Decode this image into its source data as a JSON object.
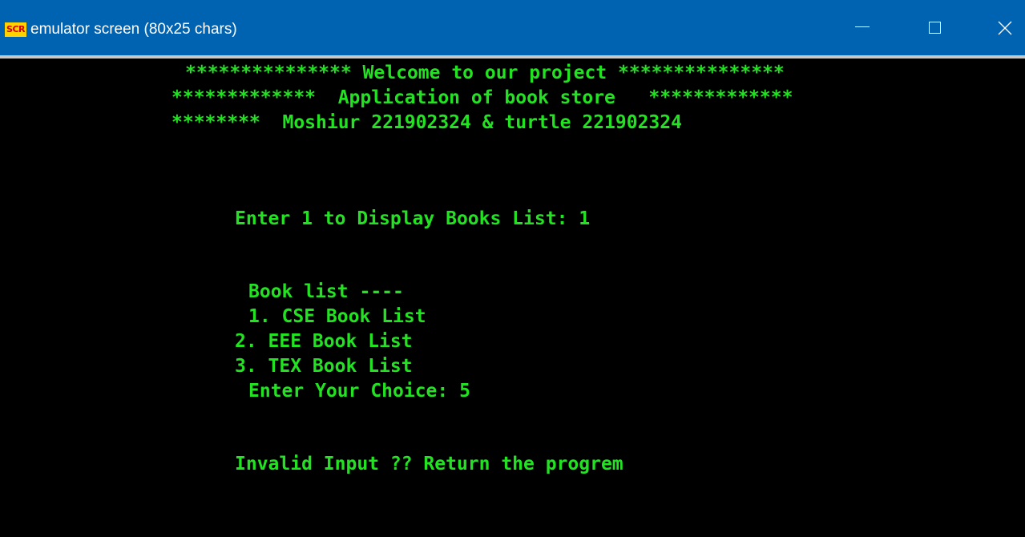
{
  "window": {
    "icon_text": "SCR",
    "title": "emulator screen (80x25 chars)"
  },
  "screen": {
    "header_line_1": "*************** Welcome to our project ***************",
    "header_line_2": "*************  Application of book store   *************",
    "header_line_3": "********  Moshiur 221902324 & turtle 221902324",
    "prompt_line": "Enter 1 to Display Books List: 1",
    "book_list_heading": "Book list ----",
    "option_1": "1. CSE Book List",
    "option_2": "2. EEE Book List",
    "option_3": "3. TEX Book List",
    "choice_prompt": "Enter Your Choice: 5",
    "error_message": "Invalid Input ?? Return the progrem"
  },
  "colors": {
    "titlebar": "#0063b1",
    "terminal_text": "#22e222",
    "terminal_background": "#000000"
  }
}
